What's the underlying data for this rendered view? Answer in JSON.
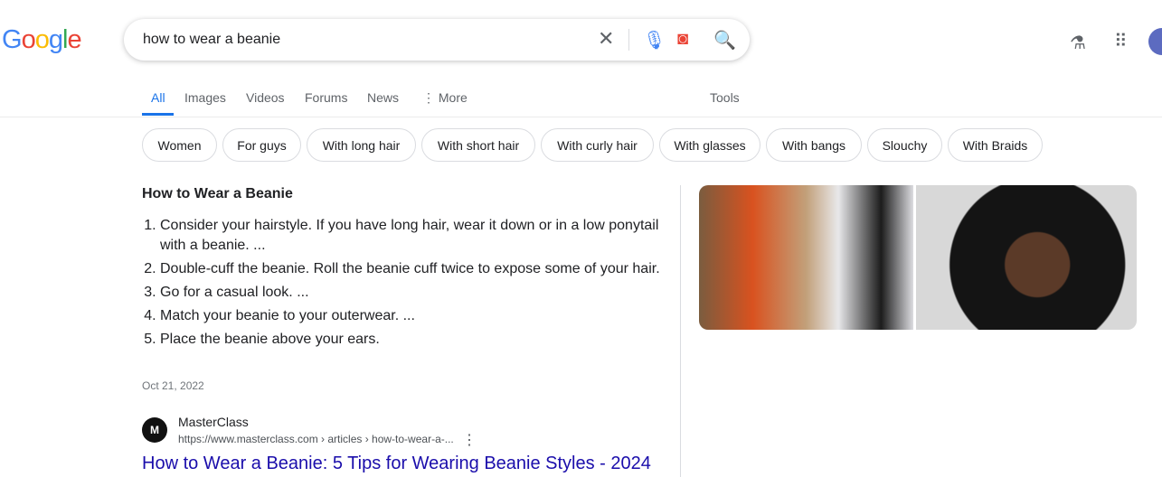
{
  "logo": "Google",
  "search": {
    "query": "how to wear a beanie",
    "icons": [
      "close-icon",
      "microphone-icon",
      "lens-icon",
      "search-icon"
    ]
  },
  "tabs": [
    "All",
    "Images",
    "Videos",
    "Forums",
    "News",
    "More",
    "Tools"
  ],
  "chips": [
    "Women",
    "For guys",
    "With long hair",
    "With short hair",
    "With curly hair",
    "With glasses",
    "With bangs",
    "Slouchy",
    "With Braids"
  ],
  "snippet": {
    "title": "How to Wear a Beanie",
    "items": [
      "Consider your hairstyle. If you have long hair, wear it down or in a low ponytail with a beanie. ...",
      "Double-cuff the beanie. Roll the beanie cuff twice to expose some of your hair.",
      "Go for a casual look. ...",
      "Match your beanie to your outerwear. ...",
      "Place the beanie above your ears."
    ],
    "date": "Oct 21, 2022"
  },
  "result": {
    "site": "MasterClass",
    "url": "https://www.masterclass.com › articles › how-to-wear-a-...",
    "title": "How to Wear a Beanie: 5 Tips for Wearing Beanie Styles - 2024"
  },
  "colors": {
    "accent": "#1a73e8",
    "link": "#1a0dab"
  }
}
